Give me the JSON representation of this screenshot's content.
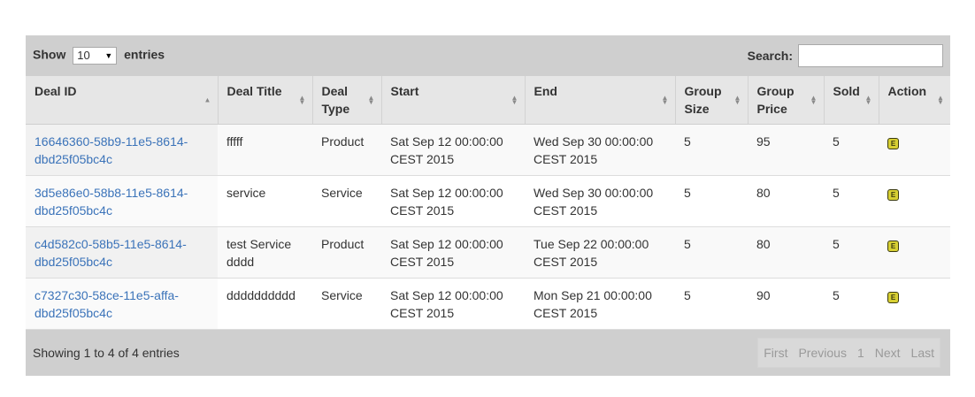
{
  "controls": {
    "show_label": "Show",
    "page_length": "10",
    "entries_label": "entries",
    "search_label": "Search:",
    "search_value": ""
  },
  "columns": [
    {
      "label": "Deal ID",
      "sort": "asc"
    },
    {
      "label": "Deal Title",
      "sort": "both"
    },
    {
      "label": "Deal Type",
      "sort": "both"
    },
    {
      "label": "Start",
      "sort": "both"
    },
    {
      "label": "End",
      "sort": "both"
    },
    {
      "label": "Group Size",
      "sort": "both"
    },
    {
      "label": "Group Price",
      "sort": "both"
    },
    {
      "label": "Sold",
      "sort": "both"
    },
    {
      "label": "Action",
      "sort": "both"
    }
  ],
  "rows": [
    {
      "id": "16646360-58b9-11e5-8614-dbd25f05bc4c",
      "title": "fffff",
      "type": "Product",
      "start": "Sat Sep 12 00:00:00 CEST 2015",
      "end": "Wed Sep 30 00:00:00 CEST 2015",
      "group_size": "5",
      "group_price": "95",
      "sold": "5",
      "action_icon": "edit-icon"
    },
    {
      "id": "3d5e86e0-58b8-11e5-8614-dbd25f05bc4c",
      "title": "service",
      "type": "Service",
      "start": "Sat Sep 12 00:00:00 CEST 2015",
      "end": "Wed Sep 30 00:00:00 CEST 2015",
      "group_size": "5",
      "group_price": "80",
      "sold": "5",
      "action_icon": "edit-icon"
    },
    {
      "id": "c4d582c0-58b5-11e5-8614-dbd25f05bc4c",
      "title": "test Service dddd",
      "type": "Product",
      "start": "Sat Sep 12 00:00:00 CEST 2015",
      "end": "Tue Sep 22 00:00:00 CEST 2015",
      "group_size": "5",
      "group_price": "80",
      "sold": "5",
      "action_icon": "edit-icon"
    },
    {
      "id": "c7327c30-58ce-11e5-affa-dbd25f05bc4c",
      "title": "dddddddddd",
      "type": "Service",
      "start": "Sat Sep 12 00:00:00 CEST 2015",
      "end": "Mon Sep 21 00:00:00 CEST 2015",
      "group_size": "5",
      "group_price": "90",
      "sold": "5",
      "action_icon": "edit-icon"
    }
  ],
  "footer": {
    "info": "Showing 1 to 4 of 4 entries",
    "first": "First",
    "previous": "Previous",
    "page": "1",
    "next": "Next",
    "last": "Last"
  },
  "colors": {
    "link": "#3b73b9",
    "edit_icon": "#d7cf33",
    "toolbar_bg": "#cfcfcf",
    "header_bg": "#e6e6e6"
  }
}
